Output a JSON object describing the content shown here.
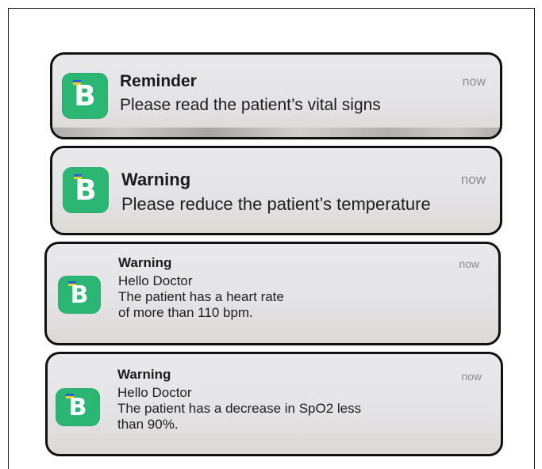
{
  "app": {
    "icon_name": "b-app-icon",
    "icon_letter": "B",
    "icon_color": "#2bb673"
  },
  "notifications": [
    {
      "title": "Reminder",
      "time": "now",
      "lines": [
        "Please read the patient’s vital signs"
      ]
    },
    {
      "title": "Warning",
      "time": "now",
      "lines": [
        "Please reduce the patient’s temperature"
      ]
    },
    {
      "title": "Warning",
      "time": "now",
      "lines": [
        "Hello Doctor",
        "The patient has a heart rate",
        "of more than 110 bpm."
      ]
    },
    {
      "title": "Warning",
      "time": "now",
      "lines": [
        "Hello Doctor",
        "The patient has a decrease in SpO2 less",
        "than 90%."
      ]
    }
  ]
}
